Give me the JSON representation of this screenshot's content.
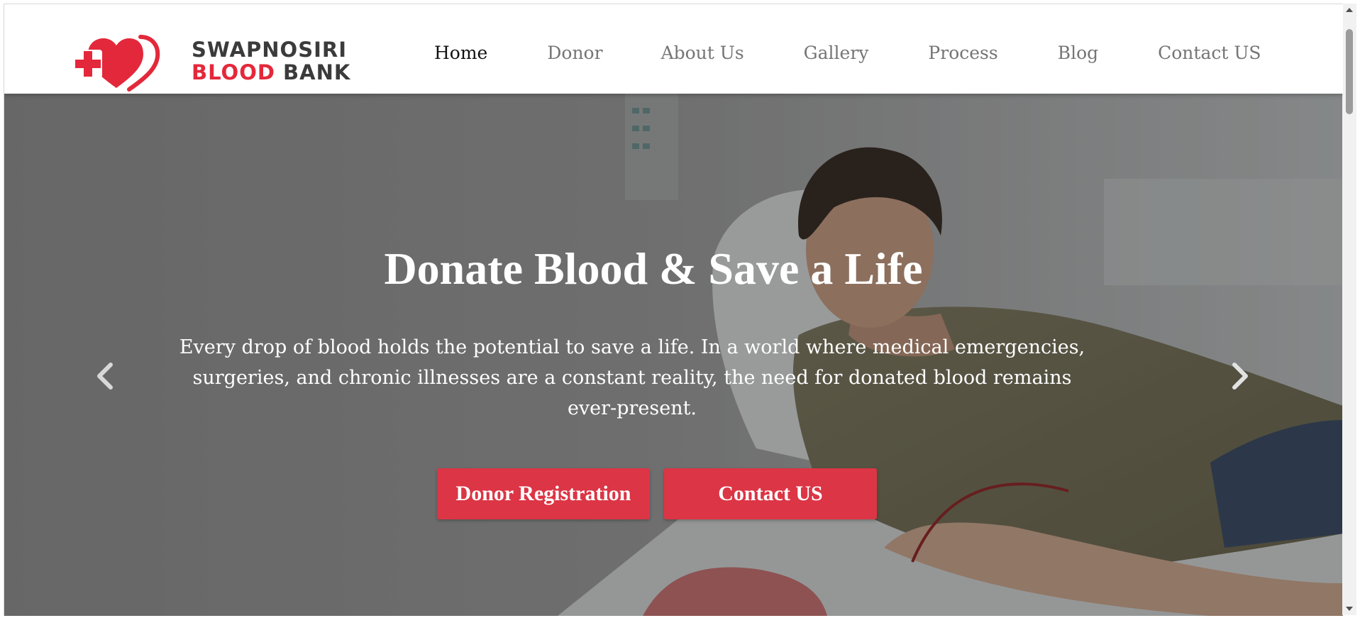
{
  "brand": {
    "line1": "SWAPNOSIRI",
    "line2_red": "BLOOD",
    "line2_dark": "BANK",
    "red_color": "#e4283b",
    "dark_color": "#3b3b3b"
  },
  "nav": {
    "items": [
      {
        "label": "Home",
        "active": true
      },
      {
        "label": "Donor",
        "active": false
      },
      {
        "label": "About Us",
        "active": false
      },
      {
        "label": "Gallery",
        "active": false
      },
      {
        "label": "Process",
        "active": false
      },
      {
        "label": "Blog",
        "active": false
      },
      {
        "label": "Contact US",
        "active": false
      }
    ]
  },
  "hero": {
    "title": "Donate Blood & Save a Life",
    "description": "Every drop of blood holds the potential to save a life. In a world where medical emergencies, surgeries, and chronic illnesses are a constant reality, the need for donated blood remains ever-present.",
    "primary_button": "Donor Registration",
    "secondary_button": "Contact US",
    "button_color": "#dc3545",
    "prev_icon": "chevron-left-icon",
    "next_icon": "chevron-right-icon"
  }
}
